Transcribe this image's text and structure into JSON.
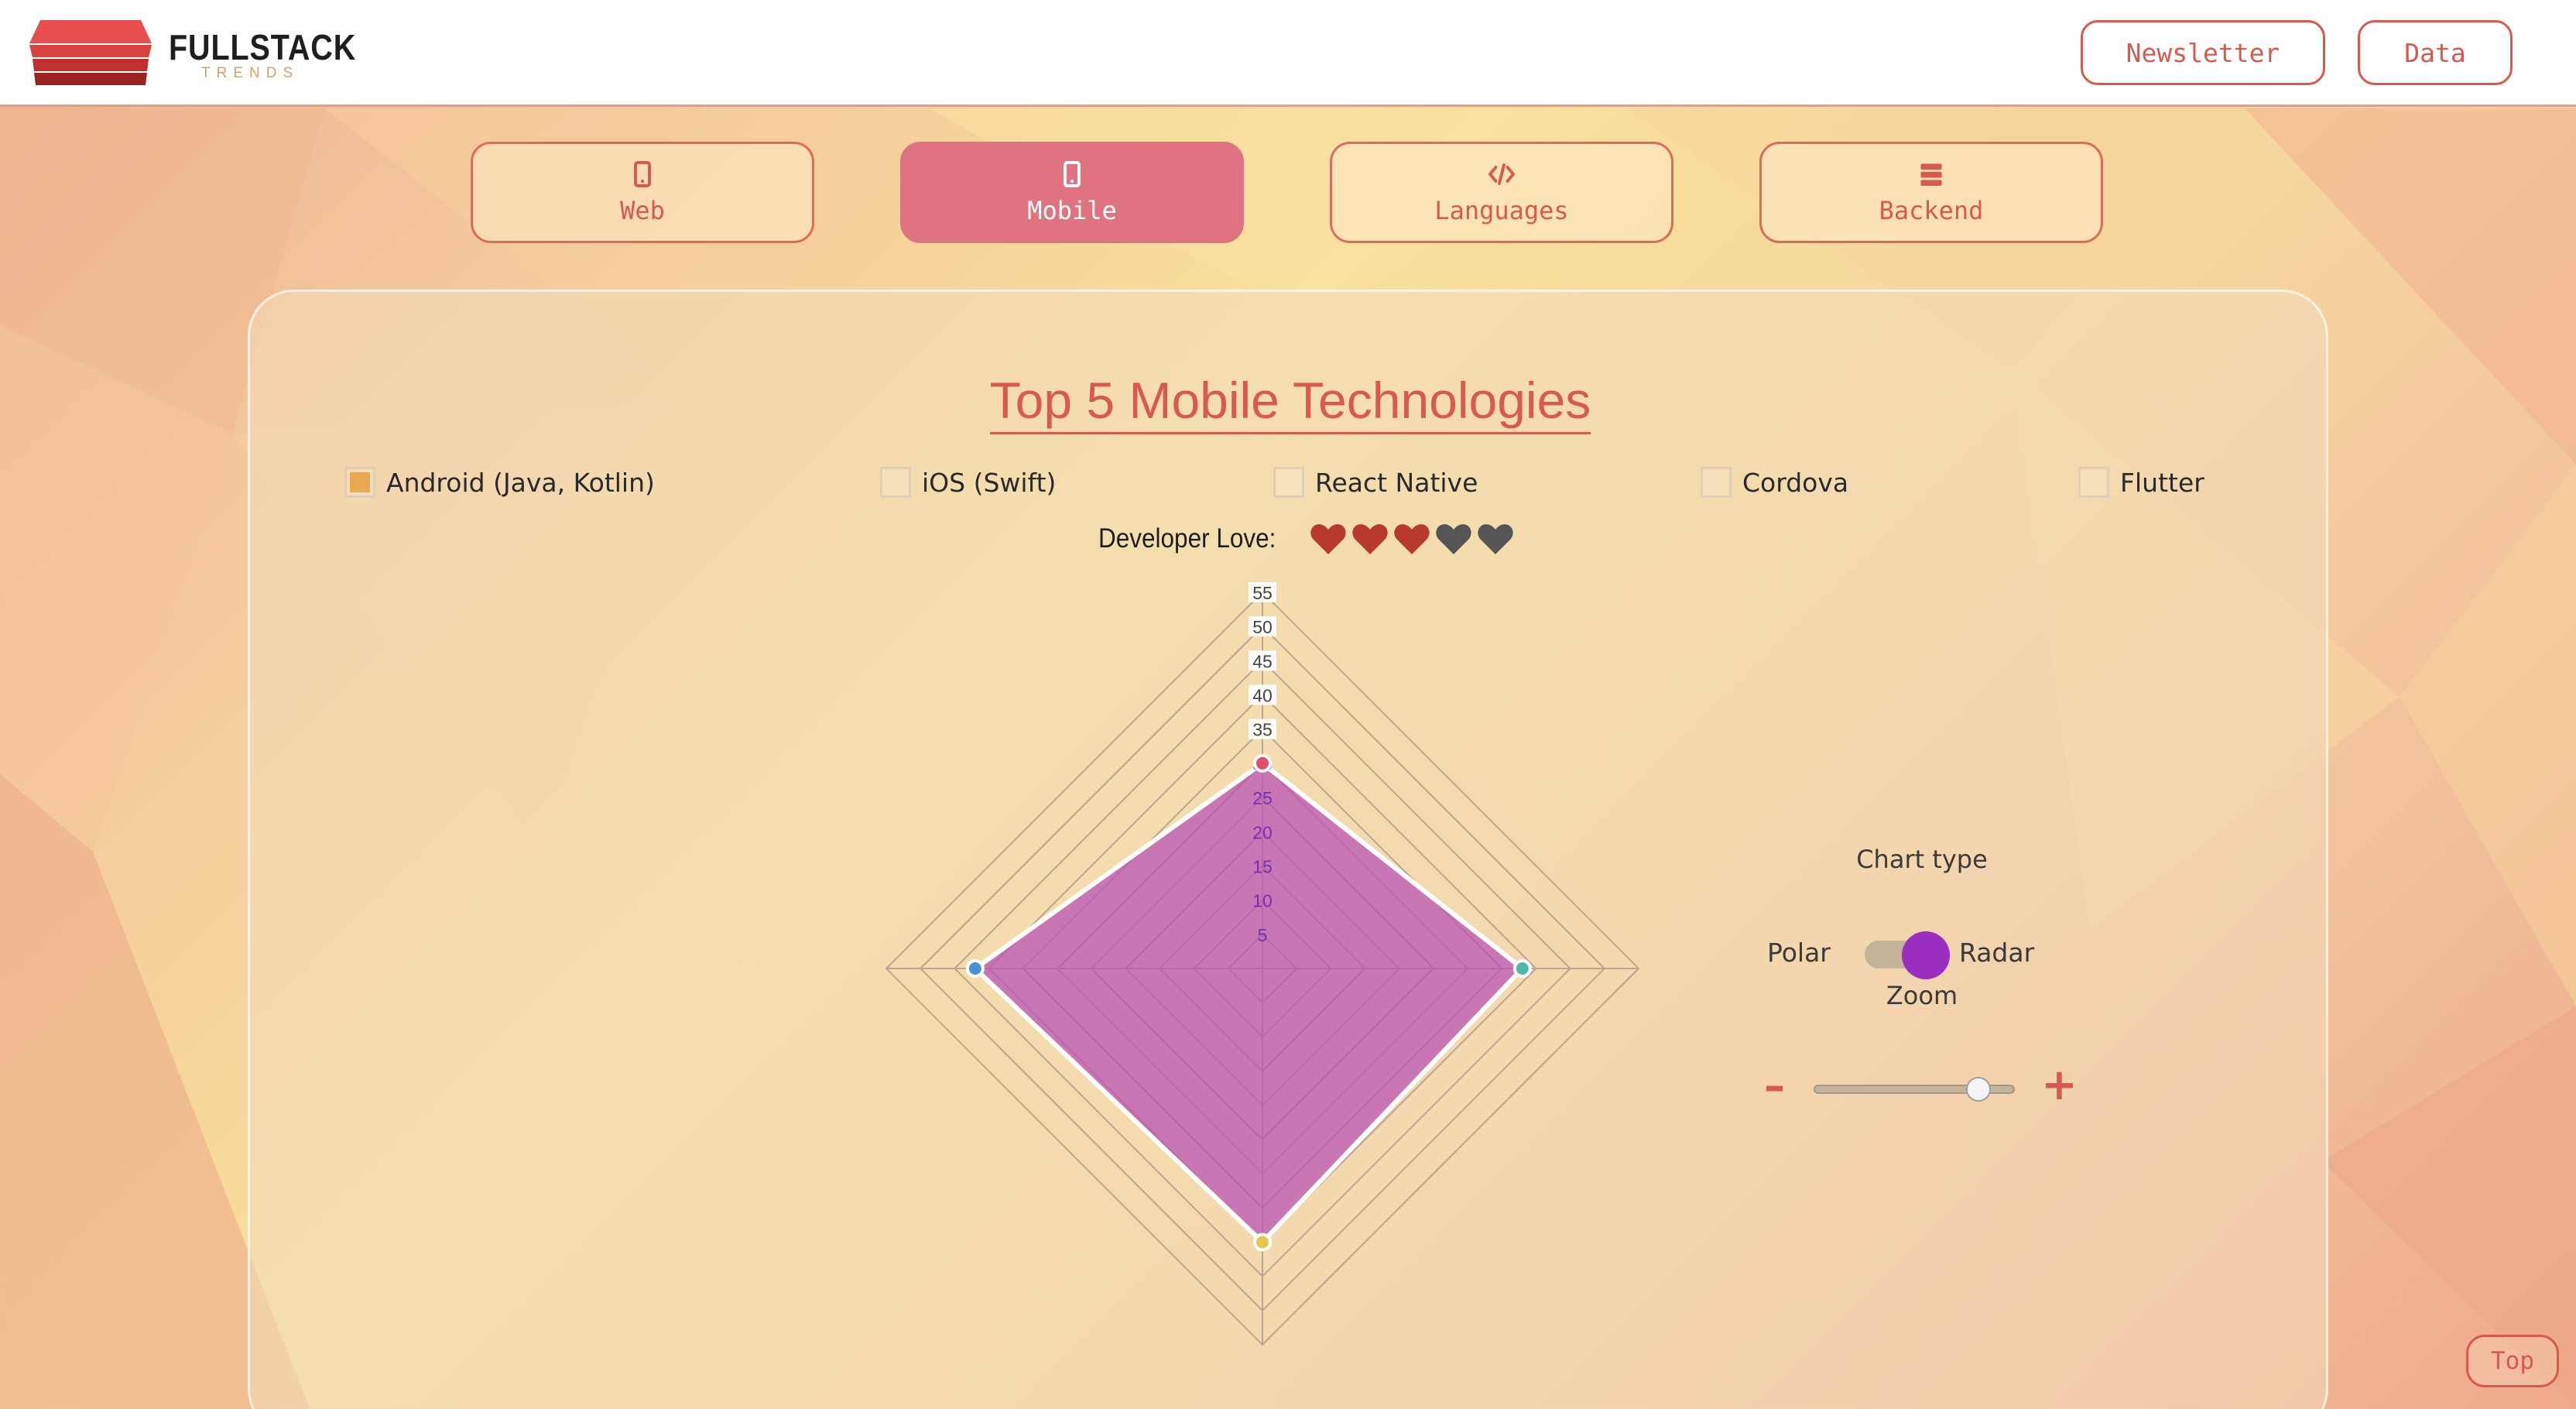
{
  "brand": {
    "name": "FULLSTACK",
    "tagline": "TRENDS",
    "colors": {
      "primary": "#d9594f",
      "logo_layers": [
        "#e84e4e",
        "#d9413f",
        "#c0302e",
        "#9a2322"
      ]
    }
  },
  "navbar": {
    "newsletter_label": "Newsletter",
    "data_label": "Data"
  },
  "tabs": [
    {
      "label": "Web",
      "icon": "mobile-phone-icon",
      "active": false
    },
    {
      "label": "Mobile",
      "icon": "mobile-phone-icon",
      "active": true
    },
    {
      "label": "Languages",
      "icon": "code-icon",
      "active": false
    },
    {
      "label": "Backend",
      "icon": "server-icon",
      "active": false
    }
  ],
  "chart_data": {
    "type": "radar",
    "title": "Top 5 Mobile Technologies",
    "legend": [
      {
        "label": "Android (Java, Kotlin)",
        "checked": true,
        "color": "#e9a94f"
      },
      {
        "label": "iOS (Swift)",
        "checked": false
      },
      {
        "label": "React Native",
        "checked": false
      },
      {
        "label": "Cordova",
        "checked": false
      },
      {
        "label": "Flutter",
        "checked": false
      }
    ],
    "developer_love": {
      "label": "Developer Love:",
      "rating": 3,
      "max": 5
    },
    "axes": [
      "top",
      "right",
      "bottom",
      "left"
    ],
    "values": [
      30,
      38,
      40,
      42
    ],
    "point_colors": [
      "#e0506a",
      "#4fb7a2",
      "#e6c548",
      "#4a90d6"
    ],
    "fill_color": "#b94fb7",
    "r_min": 0,
    "r_max": 55,
    "r_ticks": [
      5,
      10,
      15,
      20,
      25,
      30,
      35,
      40,
      45,
      50,
      55
    ]
  },
  "controls": {
    "chart_type_label": "Chart type",
    "toggle_left": "Polar",
    "toggle_right": "Radar",
    "toggle_selected": "Radar",
    "zoom_label": "Zoom",
    "zoom_minus": "–",
    "zoom_plus": "+",
    "zoom_level": 0.82
  },
  "top_button_label": "Top"
}
